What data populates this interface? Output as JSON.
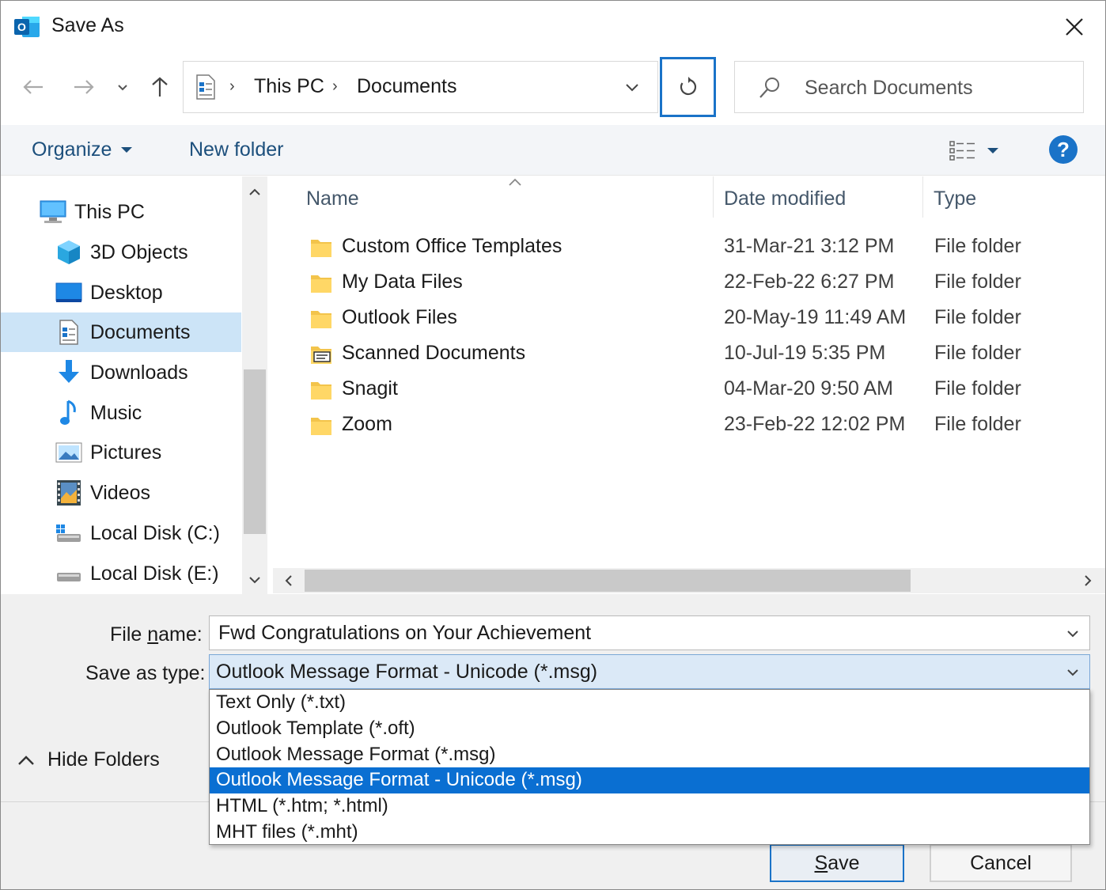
{
  "window": {
    "title": "Save As"
  },
  "address": {
    "crumbs": [
      "This PC",
      "Documents"
    ]
  },
  "search": {
    "placeholder": "Search Documents"
  },
  "toolbar": {
    "organize": "Organize",
    "new_folder": "New folder"
  },
  "nav": {
    "items": [
      {
        "label": "This PC",
        "icon": "computer-icon"
      },
      {
        "label": "3D Objects",
        "icon": "3d-objects-icon"
      },
      {
        "label": "Desktop",
        "icon": "desktop-icon"
      },
      {
        "label": "Documents",
        "icon": "documents-icon",
        "selected": true
      },
      {
        "label": "Downloads",
        "icon": "downloads-icon"
      },
      {
        "label": "Music",
        "icon": "music-icon"
      },
      {
        "label": "Pictures",
        "icon": "pictures-icon"
      },
      {
        "label": "Videos",
        "icon": "videos-icon"
      },
      {
        "label": "Local Disk (C:)",
        "icon": "local-disk-c-icon"
      },
      {
        "label": "Local Disk (E:)",
        "icon": "local-disk-e-icon"
      }
    ]
  },
  "files": {
    "columns": [
      "Name",
      "Date modified",
      "Type"
    ],
    "rows": [
      {
        "name": "Custom Office Templates",
        "date": "31-Mar-21 3:12 PM",
        "type": "File folder",
        "icon": "folder-icon"
      },
      {
        "name": "My Data Files",
        "date": "22-Feb-22 6:27 PM",
        "type": "File folder",
        "icon": "folder-icon"
      },
      {
        "name": "Outlook Files",
        "date": "20-May-19 11:49 AM",
        "type": "File folder",
        "icon": "folder-icon"
      },
      {
        "name": "Scanned Documents",
        "date": "10-Jul-19 5:35 PM",
        "type": "File folder",
        "icon": "scanned-folder-icon"
      },
      {
        "name": "Snagit",
        "date": "04-Mar-20 9:50 AM",
        "type": "File folder",
        "icon": "folder-icon"
      },
      {
        "name": "Zoom",
        "date": "23-Feb-22 12:02 PM",
        "type": "File folder",
        "icon": "folder-icon"
      }
    ]
  },
  "form": {
    "file_name_label_pre": "File ",
    "file_name_label_ul": "n",
    "file_name_label_post": "ame:",
    "file_name_value": "Fwd Congratulations on Your Achievement",
    "save_type_label": "Save as type:",
    "save_type_value": "Outlook Message Format - Unicode (*.msg)",
    "save_type_options": [
      "Text Only (*.txt)",
      "Outlook Template (*.oft)",
      "Outlook Message Format (*.msg)",
      "Outlook Message Format - Unicode (*.msg)",
      "HTML (*.htm; *.html)",
      "MHT files (*.mht)"
    ],
    "selected_option_index": 3
  },
  "footer": {
    "hide_folders": "Hide Folders",
    "save_ul": "S",
    "save_rest": "ave",
    "cancel": "Cancel"
  },
  "colors": {
    "accent": "#1a73c8",
    "selection": "#0a6fd2",
    "nav_selected": "#cce4f7",
    "link": "#1c4f7c"
  }
}
